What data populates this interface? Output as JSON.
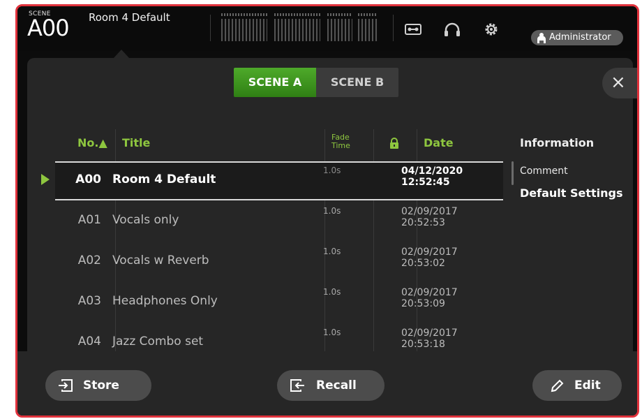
{
  "header": {
    "scene_label": "SCENE",
    "scene_number": "A00",
    "scene_name": "Room 4 Default",
    "user": "Administrator"
  },
  "tabs": [
    {
      "label": "SCENE A",
      "active": true
    },
    {
      "label": "SCENE B",
      "active": false
    }
  ],
  "close_label": "×",
  "table": {
    "headers": {
      "no": "No.▲",
      "title": "Title",
      "fade": [
        "Fade",
        "Time"
      ],
      "date": "Date",
      "information": "Information"
    },
    "rows": [
      {
        "no": "A00",
        "title": "Room 4 Default",
        "fade": "1.0s",
        "date": "04/12/2020",
        "time": "12:52:45",
        "selected": true
      },
      {
        "no": "A01",
        "title": "Vocals only",
        "fade": "1.0s",
        "date": "02/09/2017",
        "time": "20:52:53",
        "selected": false
      },
      {
        "no": "A02",
        "title": "Vocals w Reverb",
        "fade": "1.0s",
        "date": "02/09/2017",
        "time": "20:53:02",
        "selected": false
      },
      {
        "no": "A03",
        "title": "Headphones Only",
        "fade": "1.0s",
        "date": "02/09/2017",
        "time": "20:53:09",
        "selected": false
      },
      {
        "no": "A04",
        "title": "Jazz Combo set",
        "fade": "1.0s",
        "date": "02/09/2017",
        "time": "20:53:18",
        "selected": false
      }
    ]
  },
  "info": {
    "comment_label": "Comment",
    "comment_value": "Default Settings"
  },
  "buttons": {
    "store": "Store",
    "recall": "Recall",
    "edit": "Edit"
  },
  "colors": {
    "accent_green": "#8ec63f",
    "tab_active": "#3e9c1d",
    "frame_border": "#e0323c"
  }
}
